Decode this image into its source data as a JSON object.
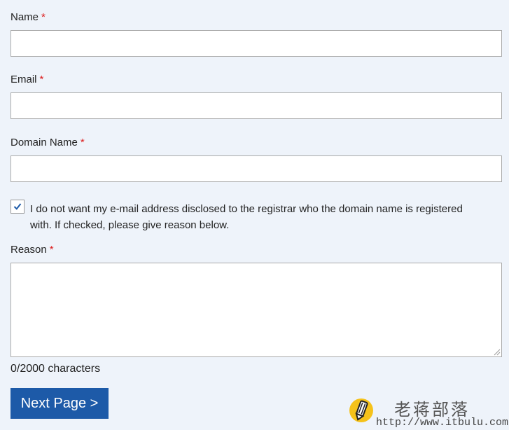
{
  "form": {
    "name": {
      "label": "Name",
      "required_mark": "*",
      "value": ""
    },
    "email": {
      "label": "Email",
      "required_mark": "*",
      "value": ""
    },
    "domain": {
      "label": "Domain Name",
      "required_mark": "*",
      "value": ""
    },
    "disclose_checkbox": {
      "checked": true,
      "label": "I do not want my e-mail address disclosed to the registrar who the domain name is registered with. If checked, please give reason below."
    },
    "reason": {
      "label": "Reason",
      "required_mark": "*",
      "value": ""
    },
    "char_count": "0/2000 characters",
    "next_button": "Next Page >"
  },
  "watermark": {
    "title": "老蒋部落",
    "url": "http://www.itbulu.com",
    "icon": "pencil-logo-icon"
  },
  "colors": {
    "background": "#eef3fa",
    "required": "#d22222",
    "button": "#1d5aa8",
    "check": "#1d5aa8"
  }
}
